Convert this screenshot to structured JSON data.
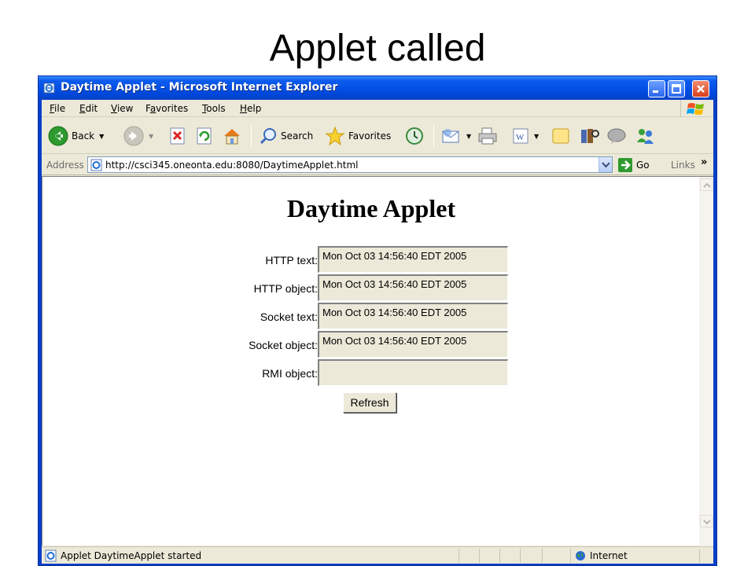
{
  "slide": {
    "title": "Applet called"
  },
  "window": {
    "title": "Daytime Applet - Microsoft Internet Explorer",
    "controls": [
      "minimize-icon",
      "maximize-icon",
      "close-icon"
    ]
  },
  "menu": {
    "items": [
      {
        "key": "F",
        "rest": "ile"
      },
      {
        "key": "E",
        "rest": "dit"
      },
      {
        "key": "V",
        "rest": "iew"
      },
      {
        "pre": "F",
        "key": "a",
        "rest": "vorites"
      },
      {
        "key": "T",
        "rest": "ools"
      },
      {
        "key": "H",
        "rest": "elp"
      }
    ]
  },
  "toolbar": {
    "back_label": "Back",
    "search_label": "Search",
    "favorites_label": "Favorites",
    "icons": [
      "back-arrow-icon",
      "forward-arrow-icon",
      "stop-icon",
      "refresh-icon",
      "home-icon",
      "search-icon",
      "favorites-star-icon",
      "history-icon",
      "mail-icon",
      "print-icon",
      "word-edit-icon",
      "note-icon",
      "research-icon",
      "messenger-icon",
      "users-icon"
    ]
  },
  "address": {
    "label": "Address",
    "url": "http://csci345.oneonta.edu:8080/DaytimeApplet.html",
    "go_label": "Go",
    "links_label": "Links",
    "more": "»"
  },
  "page": {
    "heading": "Daytime Applet",
    "rows": [
      {
        "label": "HTTP text:",
        "value": "Mon Oct 03 14:56:40 EDT 2005"
      },
      {
        "label": "HTTP object:",
        "value": "Mon Oct 03 14:56:40 EDT 2005"
      },
      {
        "label": "Socket text:",
        "value": "Mon Oct 03 14:56:40 EDT 2005"
      },
      {
        "label": "Socket object:",
        "value": "Mon Oct 03 14:56:40 EDT 2005"
      },
      {
        "label": "RMI object:",
        "value": ""
      }
    ],
    "refresh_label": "Refresh"
  },
  "status": {
    "text": "Applet DaytimeApplet started",
    "zone": "Internet"
  },
  "colors": {
    "titlebar": "#0550e6",
    "chrome": "#ece9d8",
    "field": "#ece9d8"
  }
}
